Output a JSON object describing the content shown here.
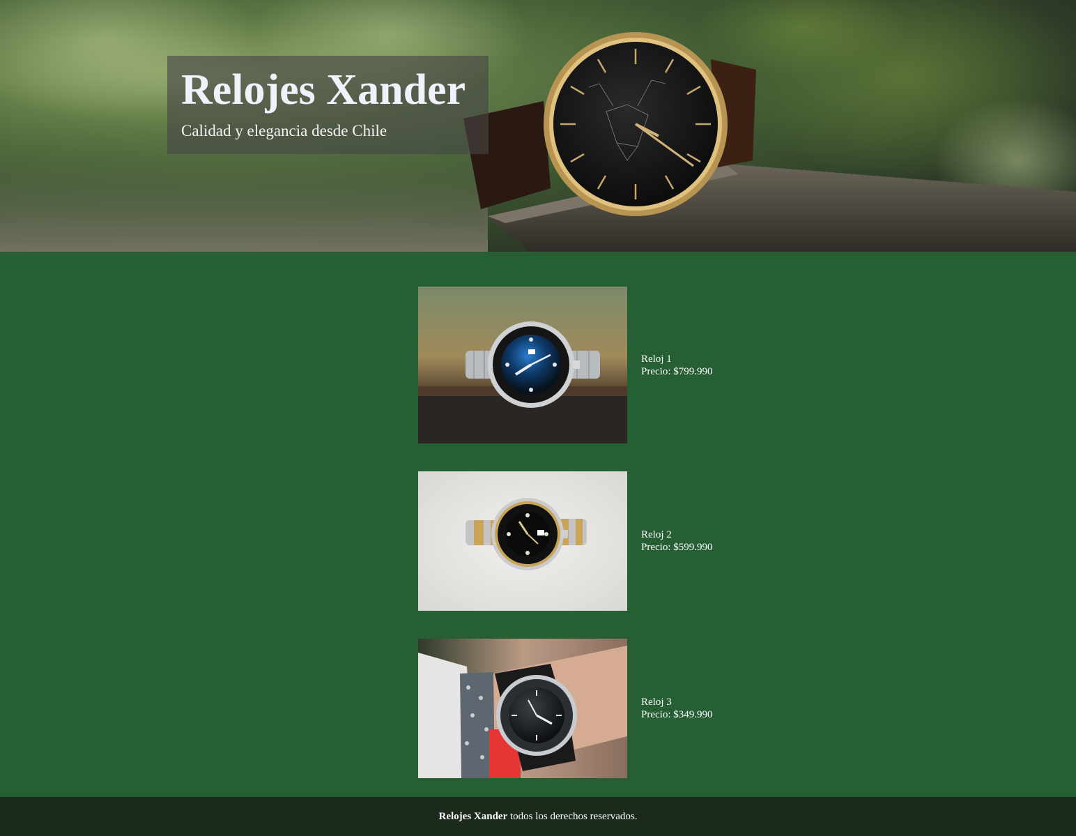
{
  "header": {
    "title": "Relojes Xander",
    "subtitle": "Calidad y elegancia desde Chile",
    "hero_image_icon": "wristwatch-hero-photo"
  },
  "products": [
    {
      "name": "Reloj 1",
      "price": "Precio: $799.990",
      "image_icon": "diver-watch-blue-photo"
    },
    {
      "name": "Reloj 2",
      "price": "Precio: $599.990",
      "image_icon": "two-tone-watch-photo"
    },
    {
      "name": "Reloj 3",
      "price": "Precio: $349.990",
      "image_icon": "wrist-watch-photo"
    }
  ],
  "footer": {
    "brand": "Relojes Xander",
    "text": " todos los derechos reservados."
  },
  "colors": {
    "page_background": "#255f33",
    "footer_background": "#1b2a1d",
    "title_box": "rgba(70,70,70,0.62)",
    "text": "#ffffff"
  }
}
